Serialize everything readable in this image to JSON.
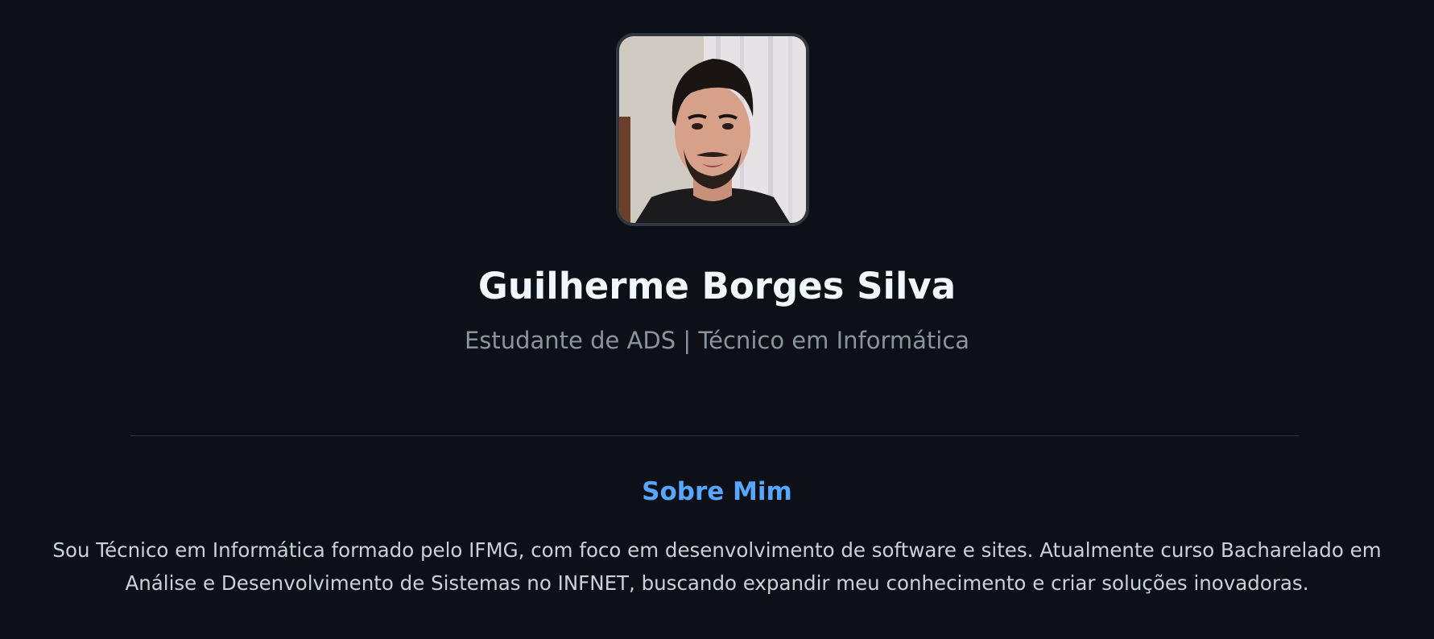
{
  "profile": {
    "name": "Guilherme Borges Silva",
    "subtitle": "Estudante de ADS | Técnico em Informática"
  },
  "about": {
    "title": "Sobre Mim",
    "text": "Sou Técnico em Informática formado pelo IFMG, com foco em desenvolvimento de software e sites. Atualmente curso Bacharelado em Análise e Desenvolvimento de Sistemas no INFNET, buscando expandir meu conhecimento e criar soluções inovadoras."
  },
  "colors": {
    "background": "#0d1117",
    "heading": "#f0f6fc",
    "muted": "#8b949e",
    "accent": "#58a6ff",
    "border": "#30363d"
  }
}
